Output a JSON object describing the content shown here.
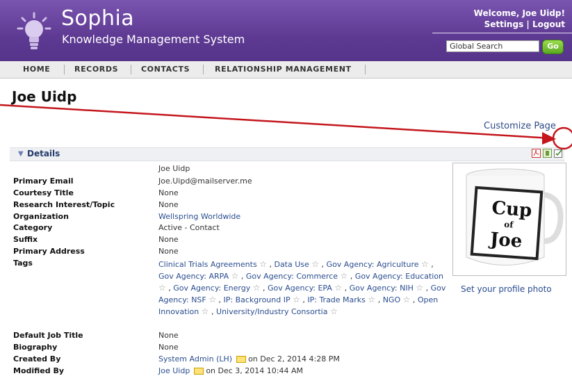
{
  "header": {
    "brand": "Sophia",
    "subtitle": "Knowledge Management System",
    "welcome": "Welcome, Joe Uidp!",
    "settings_link": "Settings",
    "link_separator": "|",
    "logout_link": "Logout",
    "search_placeholder": "Global Search",
    "go_label": "Go"
  },
  "nav": {
    "items": [
      "HOME",
      "RECORDS",
      "CONTACTS",
      "RELATIONSHIP MANAGEMENT"
    ]
  },
  "page": {
    "title": "Joe Uidp",
    "customize": "Customize Page"
  },
  "details": {
    "section_label": "Details",
    "name_value": "Joe Uidp",
    "fields": [
      {
        "label": "Primary Email",
        "value": "Joe.Uipd@mailserver.me"
      },
      {
        "label": "Courtesy Title",
        "value": "None"
      },
      {
        "label": "Research Interest/Topic",
        "value": "None"
      },
      {
        "label": "Organization",
        "value": "Wellspring Worldwide"
      },
      {
        "label": "Category",
        "value": "Active - Contact"
      },
      {
        "label": "Suffix",
        "value": "None"
      },
      {
        "label": "Primary Address",
        "value": "None"
      },
      {
        "label": "Tags",
        "value": ""
      }
    ],
    "tags": [
      "Clinical Trials Agreements",
      "Data Use",
      "Gov Agency: Agriculture",
      "Gov Agency: ARPA",
      "Gov Agency: Commerce",
      "Gov Agency: Education",
      "Gov Agency: Energy",
      "Gov Agency: EPA",
      "Gov Agency: NIH",
      "Gov Agency: NSF",
      "IP: Background IP",
      "IP: Trade Marks",
      "NGO",
      "Open Innovation",
      "University/Industry Consortia"
    ],
    "tag_separator": ",",
    "fields2": [
      {
        "label": "Default Job Title",
        "value": "None"
      },
      {
        "label": "Biography",
        "value": "None"
      },
      {
        "label": "Created By",
        "value": "System Admin (LH)",
        "suffix": "on Dec 2, 2014 4:28 PM"
      },
      {
        "label": "Modified By",
        "value": "Joe Uidp",
        "suffix": "on Dec 3, 2014 10:44 AM"
      }
    ],
    "photo_link": "Set your profile photo",
    "mug_text": [
      "Cup",
      "of",
      "Joe"
    ]
  }
}
